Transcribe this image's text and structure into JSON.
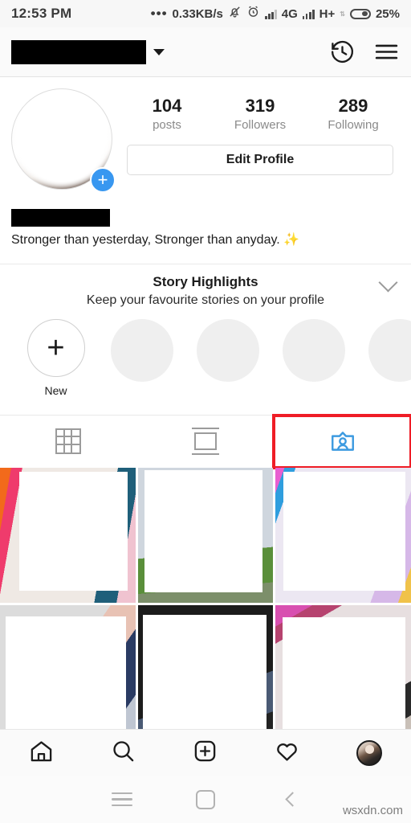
{
  "status_bar": {
    "time": "12:53 PM",
    "dots": "•••",
    "network_speed": "0.33KB/s",
    "mute_icon": "bell-muted-icon",
    "alarm_icon": "alarm-clock-icon",
    "signal_icon_1": "signal-bars-icon",
    "network_type_1": "4G",
    "signal_icon_2": "signal-bars-icon",
    "network_type_2": "H+",
    "network_type_2_sub": "↓↑",
    "battery_icon": "battery-icon",
    "battery_percent": "25%"
  },
  "app_bar": {
    "username": "",
    "username_redacted": true,
    "dropdown_icon": "chevron-down-icon",
    "archive_icon": "history-archive-icon",
    "menu_icon": "hamburger-menu-icon"
  },
  "profile": {
    "avatar_icon": "profile-avatar",
    "add_story_label": "+",
    "stats": [
      {
        "value": "104",
        "label": "posts"
      },
      {
        "value": "319",
        "label": "Followers"
      },
      {
        "value": "289",
        "label": "Following"
      }
    ],
    "edit_profile_label": "Edit Profile",
    "display_name": "",
    "display_name_redacted": true,
    "bio": "Stronger than yesterday, Stronger than anyday.",
    "bio_emoji": "✨"
  },
  "highlights": {
    "title": "Story Highlights",
    "subtitle": "Keep your favourite stories on your profile",
    "collapse_icon": "chevron-down-icon",
    "new_label": "New",
    "new_icon": "plus-icon",
    "placeholders": 4
  },
  "tabs": [
    {
      "name": "grid",
      "icon": "grid-tab-icon",
      "selected": false,
      "highlighted": false
    },
    {
      "name": "list",
      "icon": "list-tab-icon",
      "selected": false,
      "highlighted": false
    },
    {
      "name": "tagged",
      "icon": "tagged-person-tab-icon",
      "selected": true,
      "highlighted": true
    }
  ],
  "annotation": {
    "color": "#ef1d26",
    "target": "tagged-tab"
  },
  "photo_grid": {
    "cells": [
      {
        "name": "post-thumbnail-1",
        "edges": [
          "#f26a1b",
          "#ef3b6c",
          "#1f5f7a",
          "#f04e86"
        ]
      },
      {
        "name": "post-thumbnail-2",
        "edges": [
          "#cfd6de",
          "#5a8f3a",
          "#2b4a7a",
          "#d9dde2"
        ]
      },
      {
        "name": "post-thumbnail-3",
        "edges": [
          "#e85fd0",
          "#2f9ede",
          "#d6b8e8",
          "#f0c24a"
        ]
      },
      {
        "name": "post-thumbnail-4",
        "edges": [
          "#dcdcdc",
          "#e8c2b4",
          "#2a3b63",
          "#bfc6d2"
        ]
      },
      {
        "name": "post-thumbnail-5",
        "edges": [
          "#1c1c1c",
          "#2a2a2a",
          "#4a5a74",
          "#222222"
        ]
      },
      {
        "name": "post-thumbnail-6",
        "edges": [
          "#d84fb0",
          "#b6436f",
          "#2a2a2a",
          "#c9c0b8"
        ]
      }
    ]
  },
  "bottom_nav": [
    {
      "name": "home",
      "icon": "home-icon"
    },
    {
      "name": "search",
      "icon": "search-icon"
    },
    {
      "name": "add",
      "icon": "add-post-icon"
    },
    {
      "name": "activity",
      "icon": "heart-icon"
    },
    {
      "name": "profile",
      "icon": "profile-avatar-icon"
    }
  ],
  "android_nav": {
    "recents_icon": "recents-icon",
    "home_icon": "home-square-icon",
    "back_icon": "back-chevron-icon"
  },
  "watermark": "wsxdn.com"
}
